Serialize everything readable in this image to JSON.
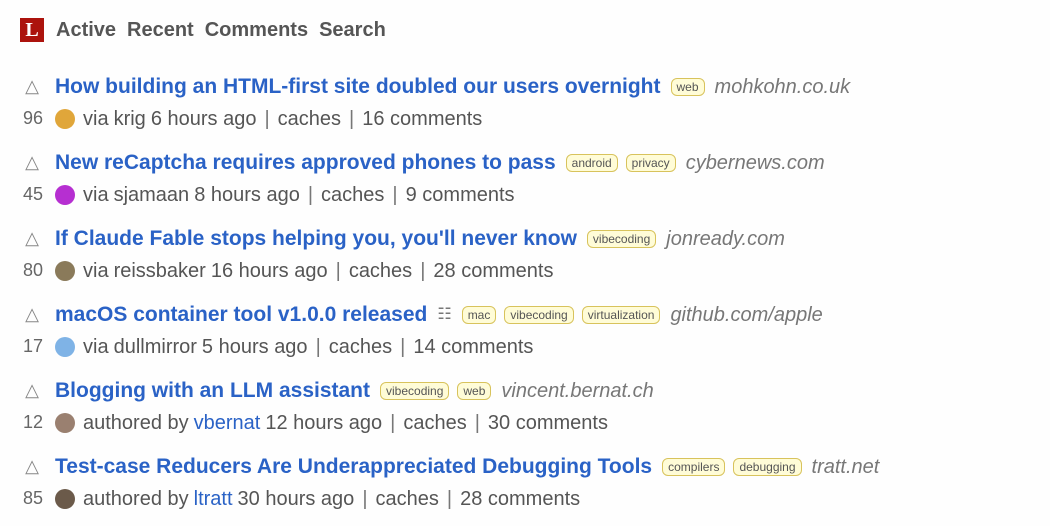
{
  "header": {
    "logo_letter": "L",
    "nav": [
      "Active",
      "Recent",
      "Comments",
      "Search"
    ]
  },
  "stories": [
    {
      "title": "How building an HTML-first site doubled our users overnight",
      "tags": [
        "web"
      ],
      "domain": "mohkohn.co.uk",
      "score": "96",
      "prefix": "via",
      "user": "krig",
      "time": "6 hours ago",
      "caches": "caches",
      "comments": "16 comments",
      "avatar_color": "#e0a63a",
      "upvote": "△"
    },
    {
      "title": "New reCaptcha requires approved phones to pass",
      "tags": [
        "android",
        "privacy"
      ],
      "domain": "cybernews.com",
      "score": "45",
      "prefix": "via",
      "user": "sjamaan",
      "time": "8 hours ago",
      "caches": "caches",
      "comments": "9 comments",
      "avatar_color": "#b62fd1",
      "upvote": "△"
    },
    {
      "title": "If Claude Fable stops helping you, you'll never know",
      "tags": [
        "vibecoding"
      ],
      "domain": "jonready.com",
      "score": "80",
      "prefix": "via",
      "user": "reissbaker",
      "time": "16 hours ago",
      "caches": "caches",
      "comments": "28 comments",
      "avatar_color": "#8a7a5a",
      "upvote": "△"
    },
    {
      "title": "macOS container tool v1.0.0 released",
      "format_icon": "☷",
      "tags": [
        "mac",
        "vibecoding",
        "virtualization"
      ],
      "domain": "github.com/apple",
      "score": "17",
      "prefix": "via",
      "user": "dullmirror",
      "time": "5 hours ago",
      "caches": "caches",
      "comments": "14 comments",
      "avatar_color": "#7fb3e6",
      "upvote": "△"
    },
    {
      "title": "Blogging with an LLM assistant",
      "tags": [
        "vibecoding",
        "web"
      ],
      "domain": "vincent.bernat.ch",
      "score": "12",
      "prefix": "authored by",
      "user": "vbernat",
      "time": "12 hours ago",
      "caches": "caches",
      "comments": "30 comments",
      "avatar_color": "#9a8070",
      "upvote": "△"
    },
    {
      "title": "Test-case Reducers Are Underappreciated Debugging Tools",
      "tags": [
        "compilers",
        "debugging"
      ],
      "domain": "tratt.net",
      "score": "85",
      "prefix": "authored by",
      "user": "ltratt",
      "time": "30 hours ago",
      "caches": "caches",
      "comments": "28 comments",
      "avatar_color": "#6b5a4a",
      "upvote": "△"
    }
  ]
}
